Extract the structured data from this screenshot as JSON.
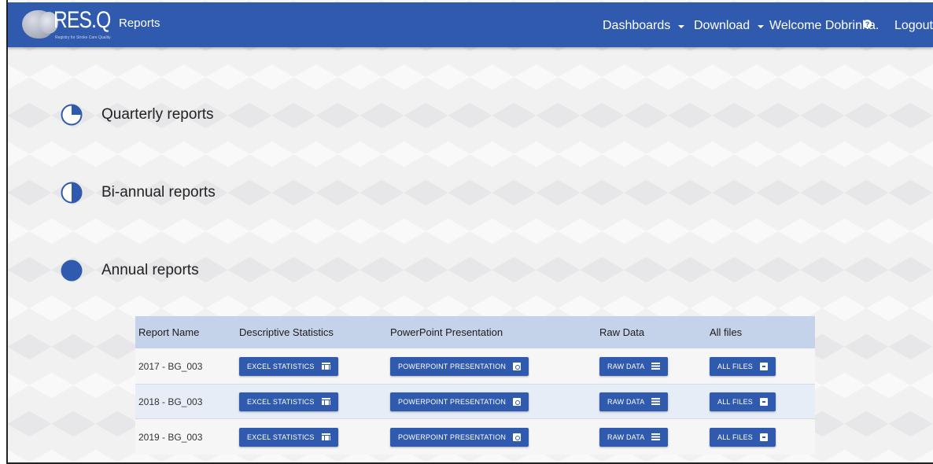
{
  "navbar": {
    "logo_text": "RES.Q",
    "logo_subtitle": "Registry for Stroke Care Quality",
    "title": "Reports",
    "dashboards_label": "Dashboards",
    "download_label": "Download",
    "welcome_label": "Welcome Dobrinka.",
    "help_glyph": "?",
    "logout_label": "Logout"
  },
  "sections": {
    "quarterly": {
      "title": "Quarterly reports",
      "icon": "quarter-pie-icon"
    },
    "biannual": {
      "title": "Bi-annual reports",
      "icon": "half-pie-icon"
    },
    "annual": {
      "title": "Annual reports",
      "icon": "full-circle-icon"
    }
  },
  "table": {
    "headers": [
      "Report Name",
      "Descriptive Statistics",
      "PowerPoint Presentation",
      "Raw Data",
      "All files"
    ],
    "rows": [
      {
        "name": "2017 - BG_003",
        "excel": "EXCEL STATISTICS",
        "ppt": "POWERPOINT PRESENTATION",
        "raw": "RAW DATA",
        "all": "ALL FILES"
      },
      {
        "name": "2018 - BG_003",
        "excel": "EXCEL STATISTICS",
        "ppt": "POWERPOINT PRESENTATION",
        "raw": "RAW DATA",
        "all": "ALL FILES"
      },
      {
        "name": "2019 - BG_003",
        "excel": "EXCEL STATISTICS",
        "ppt": "POWERPOINT PRESENTATION",
        "raw": "RAW DATA",
        "all": "ALL FILES"
      }
    ]
  },
  "colors": {
    "primary": "#2f5aad",
    "table_header": "#c4d2ea"
  }
}
